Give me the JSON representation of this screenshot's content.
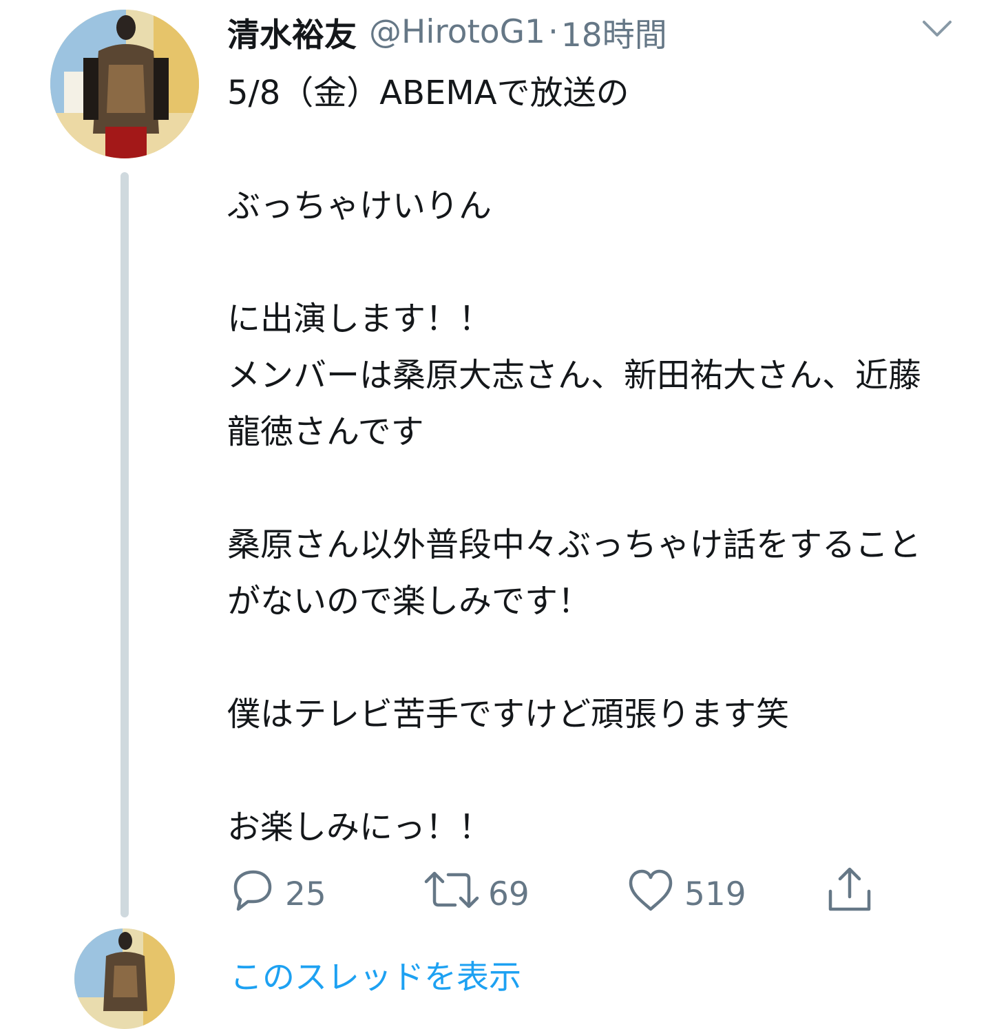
{
  "tweet": {
    "author_name": "清水裕友",
    "handle": "@HirotoG1",
    "separator": "·",
    "timestamp": "18時間",
    "text": "5/8（金）ABEMAで放送の\n\nぶっちゃけいりん\n\nに出演します！！\nメンバーは桑原大志さん、新田祐大さん、近藤龍徳さんです\n\n桑原さん以外普段中々ぶっちゃけ話をすることがないので楽しみです！\n\n僕はテレビ苦手ですけど頑張ります笑\n\nお楽しみにっ！！",
    "menu_icon": "chevron-down-icon"
  },
  "actions": {
    "reply_count": "25",
    "retweet_count": "69",
    "like_count": "519"
  },
  "thread": {
    "show_thread_label": "このスレッドを表示"
  },
  "colors": {
    "text": "#14171a",
    "secondary": "#657786",
    "link": "#1da1f2",
    "thread_line": "#cfd9de"
  }
}
